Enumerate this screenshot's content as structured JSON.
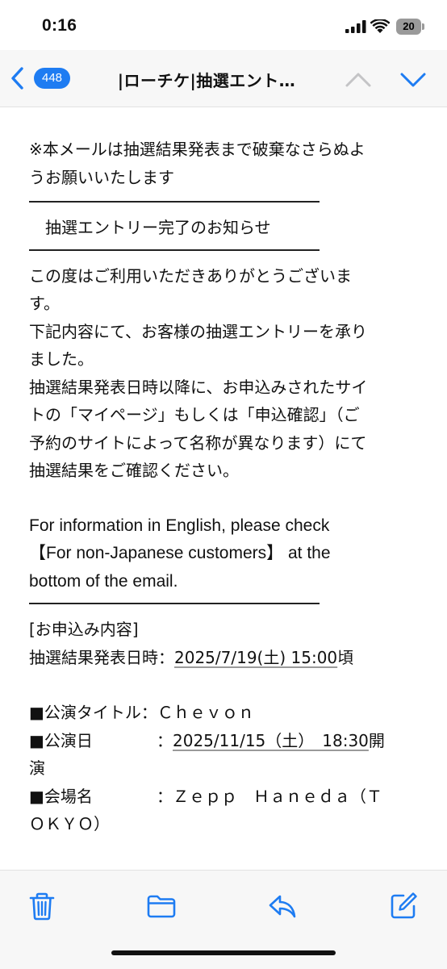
{
  "status_bar": {
    "time": "0:16",
    "battery": "20"
  },
  "header": {
    "unread_count": "448",
    "subject": "|ローチケ|抽選エント…",
    "accent_color": "#1e7cf2"
  },
  "email": {
    "notice_line1": "※本メールは抽選結果発表まで破棄なさらぬよ",
    "notice_line2": "うお願いいたします",
    "divider": "──────────────────",
    "heading": "抽選エントリー完了のお知らせ",
    "thanks_line1": "この度はご利用いただきありがとうございま",
    "thanks_line2": "す。",
    "accept_line1": "下記内容にて、お客様の抽選エントリーを承り",
    "accept_line2": "ました。",
    "result_line1": "抽選結果発表日時以降に、お申込みされたサイ",
    "result_line2": "トの「マイページ」もしくは「申込確認」（ご",
    "result_line3": "予約のサイトによって名称が異なります）にて",
    "result_line4": "抽選結果をご確認ください。",
    "english_line1": "For information in English, please check",
    "english_line2": "【For non-Japanese customers】 at the",
    "english_line3": "bottom of the email.",
    "section_label": "[お申込み内容]",
    "announce_label": "抽選結果発表日時：",
    "announce_date": "2025/7/19(土) 15:00",
    "announce_suffix": "頃",
    "title_label": "■公演タイトル：",
    "title_value": "Ｃｈｅｖｏｎ",
    "date_label": "■公演日",
    "date_colon": "：",
    "date_value": "2025/11/15（土）　18:30",
    "date_suffix_1": "開",
    "date_suffix_2": "演",
    "venue_label": "■会場名",
    "venue_colon": "：",
    "venue_value_1": "Ｚｅｐｐ　Ｈａｎｅｄａ（Ｔ",
    "venue_value_2": "ＯＫＹＯ）"
  },
  "icons": {
    "back": "chevron-left-icon",
    "prev": "chevron-up-icon",
    "next": "chevron-down-icon",
    "trash": "trash-icon",
    "folder": "folder-icon",
    "reply": "reply-icon",
    "compose": "compose-icon"
  }
}
